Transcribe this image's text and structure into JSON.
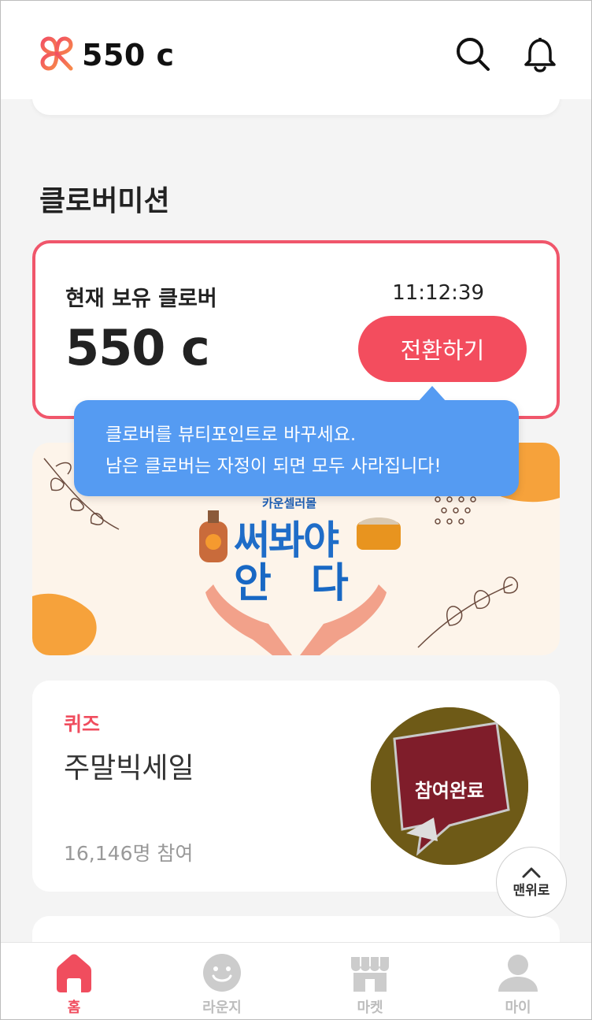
{
  "header": {
    "balance": "550 c",
    "logo_icon": "clover-logo-icon",
    "search_icon": "search-icon",
    "bell_icon": "bell-icon"
  },
  "section": {
    "title": "클로버미션"
  },
  "clover_card": {
    "label": "현재 보유 클로버",
    "amount": "550 c",
    "time": "11:12:39",
    "button_label": "전환하기"
  },
  "tooltip": {
    "line1": "클로버를 뷰티포인트로 바꾸세요.",
    "line2": "남은 클로버는 자정이 되면 모두 사라집니다!"
  },
  "banner": {
    "brand": "카운셀러몰",
    "title_line1": "써봐야",
    "title_line2": "안다"
  },
  "quiz_card": {
    "tag": "퀴즈",
    "title": "주말빅세일",
    "participants": "16,146명 참여",
    "thumb_label": "참여완료"
  },
  "top_button": {
    "label": "맨위로"
  },
  "bottom_nav": {
    "items": [
      {
        "label": "홈",
        "icon": "home-icon",
        "active": true
      },
      {
        "label": "라운지",
        "icon": "smile-icon",
        "active": false
      },
      {
        "label": "마켓",
        "icon": "store-icon",
        "active": false
      },
      {
        "label": "마이",
        "icon": "user-icon",
        "active": false
      }
    ]
  },
  "colors": {
    "accent": "#f04d5e",
    "tooltip": "#559bf2",
    "nav_inactive": "#cccccc"
  }
}
